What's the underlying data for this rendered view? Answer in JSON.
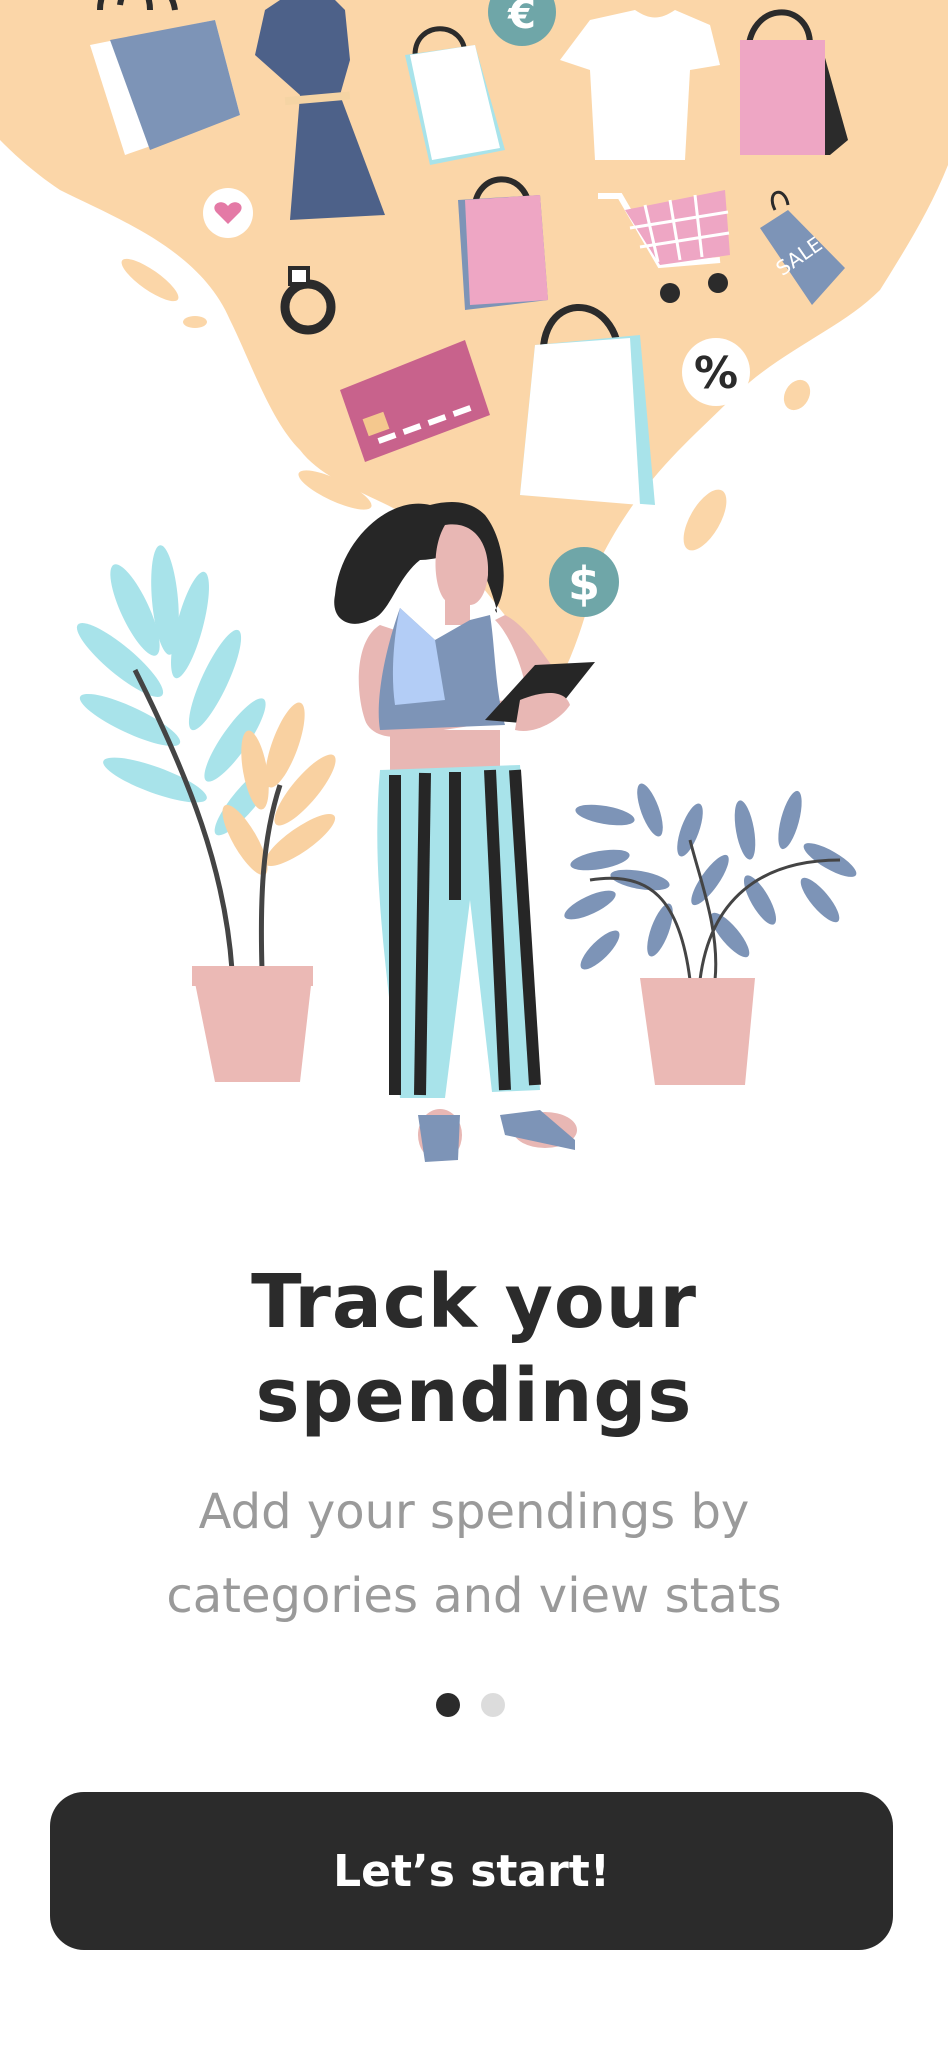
{
  "onboarding": {
    "title_line1": "Track your",
    "title_line2": "spendings",
    "subtitle_line1": "Add your spendings by",
    "subtitle_line2": "categories and view stats",
    "cta_label": "Let’s start!",
    "pager": {
      "total": 2,
      "active": 1
    }
  },
  "illustration": {
    "icons": [
      "shopping-bag-icon",
      "dress-icon",
      "euro-coin-icon",
      "tshirt-icon",
      "heart-icon",
      "ring-icon",
      "credit-card-icon",
      "shopping-cart-icon",
      "sale-tag-icon",
      "percent-icon",
      "dollar-coin-icon",
      "plant-icon",
      "woman-with-tablet-icon"
    ],
    "sale_tag_text": "SALE",
    "euro_symbol": "€",
    "dollar_symbol": "$",
    "percent_symbol": "%"
  },
  "colors": {
    "peach": "#fbd6a8",
    "dark": "#2b2b2b",
    "slate_blue": "#7a92b6",
    "pink": "#eea6c4",
    "teal": "#a8e3ea",
    "muted_text": "#9a9a9a"
  }
}
